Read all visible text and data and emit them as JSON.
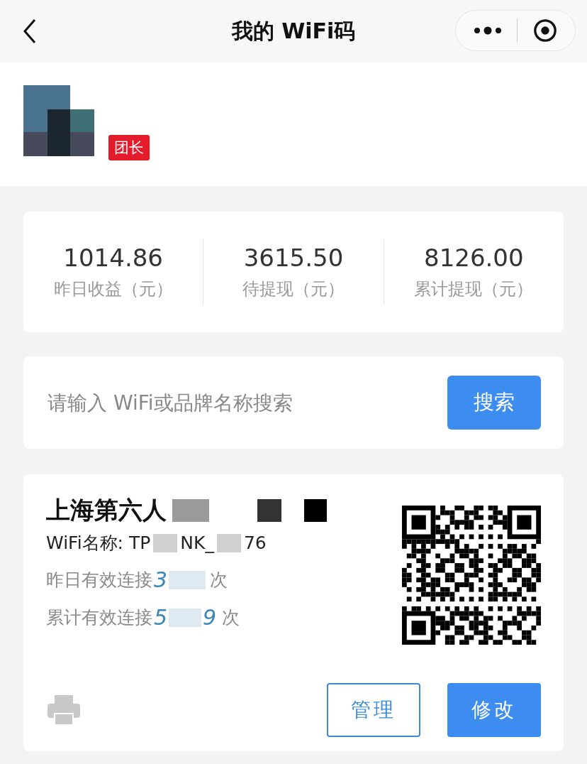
{
  "nav": {
    "title": "我的 WiFi码"
  },
  "profile": {
    "badge": "团长"
  },
  "stats": [
    {
      "value": "1014.86",
      "label": "昨日收益（元）"
    },
    {
      "value": "3615.50",
      "label": "待提现（元）"
    },
    {
      "value": "8126.00",
      "label": "累计提现（元）"
    }
  ],
  "search": {
    "placeholder": "请输入 WiFi或品牌名称搜索",
    "button": "搜索"
  },
  "wifi_card": {
    "title": "上海第六人",
    "name_parts": [
      "WiFi名称: TP",
      "NK_",
      "76"
    ],
    "yesterday": {
      "label": "昨日有效连接",
      "parts": [
        "3"
      ],
      "unit": "次"
    },
    "total": {
      "label": "累计有效连接",
      "parts": [
        "5",
        "9"
      ],
      "unit": "次"
    },
    "buttons": [
      {
        "label": "管理",
        "kind": "outline"
      },
      {
        "label": "修改",
        "kind": "primary"
      }
    ]
  }
}
